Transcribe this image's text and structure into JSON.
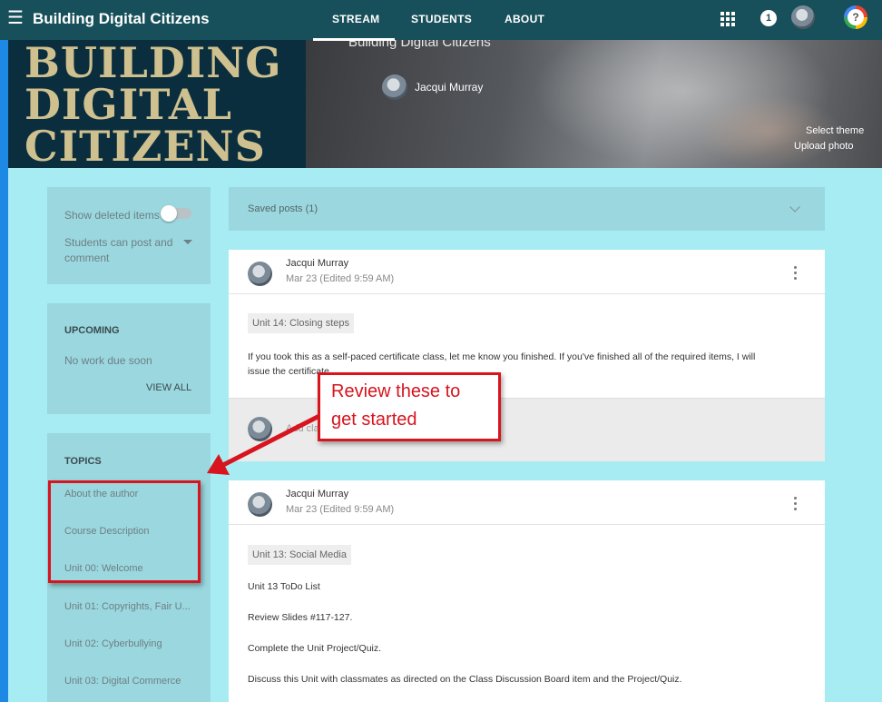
{
  "topbar": {
    "title": "Building Digital Citizens",
    "tabs": [
      {
        "label": "STREAM",
        "active": true
      },
      {
        "label": "STUDENTS",
        "active": false
      },
      {
        "label": "ABOUT",
        "active": false
      }
    ],
    "notification_count": "1",
    "help_glyph": "?",
    "icons": [
      "menu-icon",
      "apps-grid-icon",
      "notification-badge",
      "user-avatar",
      "help-icon"
    ]
  },
  "banner": {
    "logo_lines": [
      "BUILDING",
      "DIGITAL",
      "CITIZENS"
    ],
    "course_title": "Building Digital Citizens",
    "teacher_name": "Jacqui Murray",
    "select_theme": "Select theme",
    "upload_photo": "Upload photo"
  },
  "sidebar": {
    "settings": {
      "show_deleted_label": "Show deleted items",
      "show_deleted_on": false,
      "students_can_post_label": "Students can post and",
      "students_can_post_label_2": "comment"
    },
    "upcoming": {
      "title": "UPCOMING",
      "empty_text": "No work due soon",
      "view_all": "VIEW ALL"
    },
    "topics": {
      "title": "TOPICS",
      "items": [
        "About the author",
        "Course Description",
        "Unit 00: Welcome",
        "Unit 01: Copyrights, Fair U...",
        "Unit 02: Cyberbullying",
        "Unit 03: Digital Commerce"
      ]
    }
  },
  "stream": {
    "saved_posts": "Saved posts (1)",
    "posts": [
      {
        "author": "Jacqui Murray",
        "date": "Mar 23 (Edited 9:59 AM)",
        "topic_chip": "Unit 14: Closing steps",
        "body": [
          "If you took this as a self-paced certificate class, let me know you finished. If you've finished all of the required items, I will",
          "issue the certificate."
        ],
        "comment_placeholder": "Add class comment..."
      },
      {
        "author": "Jacqui Murray",
        "date": "Mar 23 (Edited 9:59 AM)",
        "topic_chip": "Unit 13: Social Media",
        "body": [
          "Unit 13 ToDo List",
          "Review Slides #117-127.",
          "Complete the Unit Project/Quiz.",
          "Discuss this Unit with classmates as directed on the Class Discussion Board item and the Project/Quiz."
        ]
      }
    ]
  },
  "annotation": {
    "callout_lines": [
      "Review these to",
      "get started"
    ],
    "color": "#d8141e"
  },
  "colors": {
    "topbar": "#17505a",
    "page_background": "#a8ecf3",
    "sidebar_card": "#9ad7de",
    "banner_logo_text": "#cfc08f"
  }
}
